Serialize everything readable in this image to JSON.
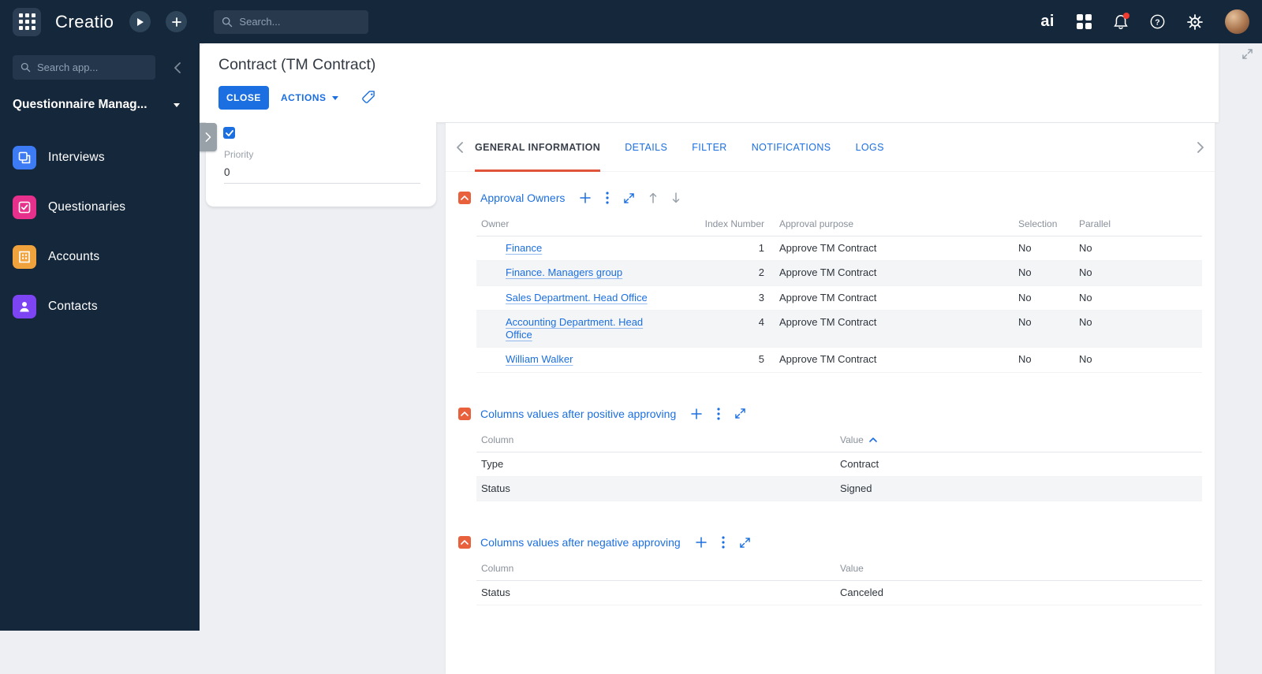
{
  "colors": {
    "topbar_bg": "#15273B",
    "accent_blue": "#1B6FE0",
    "active_tab_underline": "#E0543C",
    "section_icon_orange": "#E8603C",
    "notification_dot": "#F03B2E",
    "row_stripe": "#F4F5F7"
  },
  "topbar": {
    "logo": "Creatio",
    "search_placeholder": "Search...",
    "ai_label": "ai",
    "right_icons": [
      "ai-copilot",
      "apps-grid-icon",
      "notifications-bell-icon",
      "help-icon",
      "settings-gear-icon",
      "avatar"
    ]
  },
  "sidebar": {
    "search_placeholder": "Search app...",
    "workspace": "Questionnaire Manag...",
    "items": [
      {
        "label": "Interviews",
        "color": "#3D7BF5"
      },
      {
        "label": "Questionaries",
        "color": "#E7308C"
      },
      {
        "label": "Accounts",
        "color": "#F0A23C"
      },
      {
        "label": "Contacts",
        "color": "#7C44F2"
      }
    ]
  },
  "record": {
    "title": "Contract (TM Contract)",
    "close_label": "CLOSE",
    "actions_label": "ACTIONS",
    "priority_label": "Priority",
    "priority_value": "0"
  },
  "tabs": {
    "items": [
      "GENERAL INFORMATION",
      "DETAILS",
      "FILTER",
      "NOTIFICATIONS",
      "LOGS"
    ],
    "active": "GENERAL INFORMATION"
  },
  "sections": {
    "approval": {
      "title": "Approval Owners",
      "headers": {
        "owner": "Owner",
        "index": "Index Number",
        "purpose": "Approval purpose",
        "selection": "Selection",
        "parallel": "Parallel"
      },
      "rows": [
        {
          "owner": "Finance",
          "index": "1",
          "purpose": "Approve TM Contract",
          "selection": "No",
          "parallel": "No"
        },
        {
          "owner": "Finance. Managers group",
          "index": "2",
          "purpose": "Approve TM Contract",
          "selection": "No",
          "parallel": "No"
        },
        {
          "owner": "Sales Department. Head Office",
          "index": "3",
          "purpose": "Approve TM Contract",
          "selection": "No",
          "parallel": "No"
        },
        {
          "owner": "Accounting Department. Head Office",
          "index": "4",
          "purpose": "Approve TM Contract",
          "selection": "No",
          "parallel": "No"
        },
        {
          "owner": "William Walker",
          "index": "5",
          "purpose": "Approve TM Contract",
          "selection": "No",
          "parallel": "No"
        }
      ]
    },
    "positive": {
      "title": "Columns values after positive approving",
      "headers": {
        "column": "Column",
        "value": "Value"
      },
      "rows": [
        {
          "column": "Type",
          "value": "Contract"
        },
        {
          "column": "Status",
          "value": "Signed"
        }
      ]
    },
    "negative": {
      "title": "Columns values after negative approving",
      "headers": {
        "column": "Column",
        "value": "Value"
      },
      "rows": [
        {
          "column": "Status",
          "value": "Canceled"
        }
      ]
    }
  }
}
